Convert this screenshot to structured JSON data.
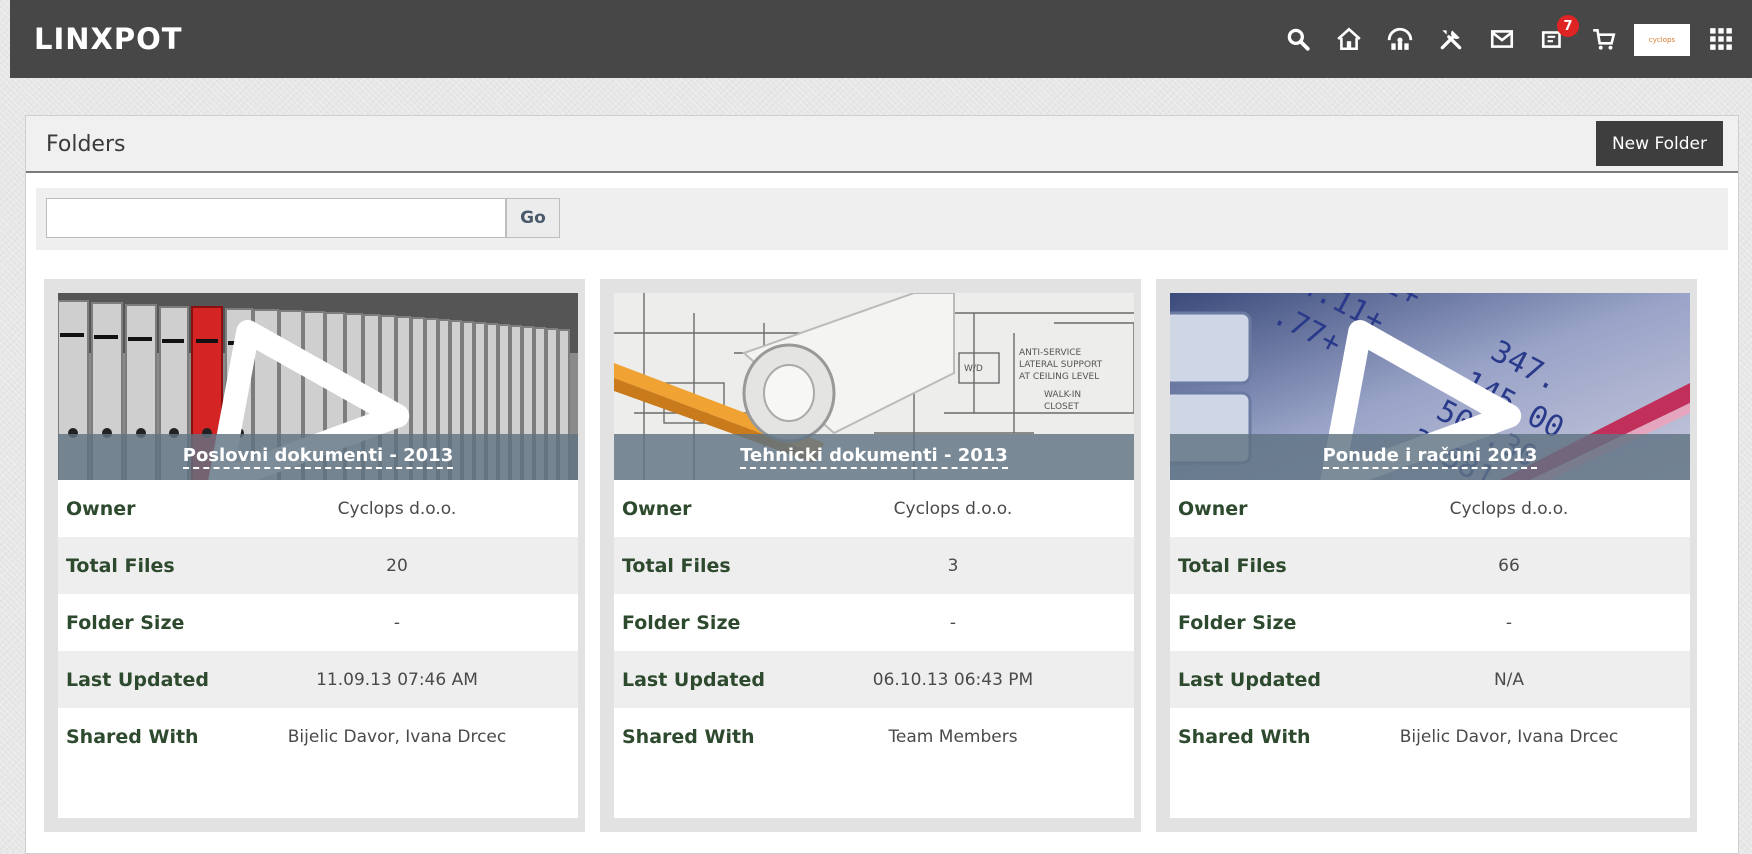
{
  "app": {
    "brand": "LINXPOT"
  },
  "header": {
    "notification_count": "7",
    "profile_logo_text": "cyclops"
  },
  "panel": {
    "title": "Folders",
    "new_folder_label": "New Folder"
  },
  "search": {
    "value": "",
    "placeholder": "",
    "go_label": "Go"
  },
  "labels": {
    "owner": "Owner",
    "total_files": "Total Files",
    "folder_size": "Folder Size",
    "last_updated": "Last Updated",
    "shared_with": "Shared With"
  },
  "folders": [
    {
      "name": "Poslovni dokumenti - 2013",
      "brand": "cyclops",
      "owner": "Cyclops d.o.o.",
      "total_files": "20",
      "folder_size": "-",
      "last_updated": "11.09.13 07:46 AM",
      "shared_with": "Bijelic Davor, Ivana Drcec"
    },
    {
      "name": "Tehnicki dokumenti - 2013",
      "brand": "",
      "owner": "Cyclops d.o.o.",
      "total_files": "3",
      "folder_size": "-",
      "last_updated": "06.10.13 06:43 PM",
      "shared_with": "Team Members"
    },
    {
      "name": "Ponude i računi 2013",
      "brand": "cyclops",
      "owner": "Cyclops d.o.o.",
      "total_files": "66",
      "folder_size": "-",
      "last_updated": "N/A",
      "shared_with": "Bijelic Davor, Ivana Drcec"
    }
  ],
  "icons": [
    "search-icon",
    "home-icon",
    "network-icon",
    "tools-icon",
    "mail-icon",
    "notifications-icon",
    "cart-icon",
    "apps-grid-icon"
  ],
  "colors": {
    "topbar": "#474747",
    "label_green": "#2e4a2e",
    "badge_red": "#e02424"
  }
}
